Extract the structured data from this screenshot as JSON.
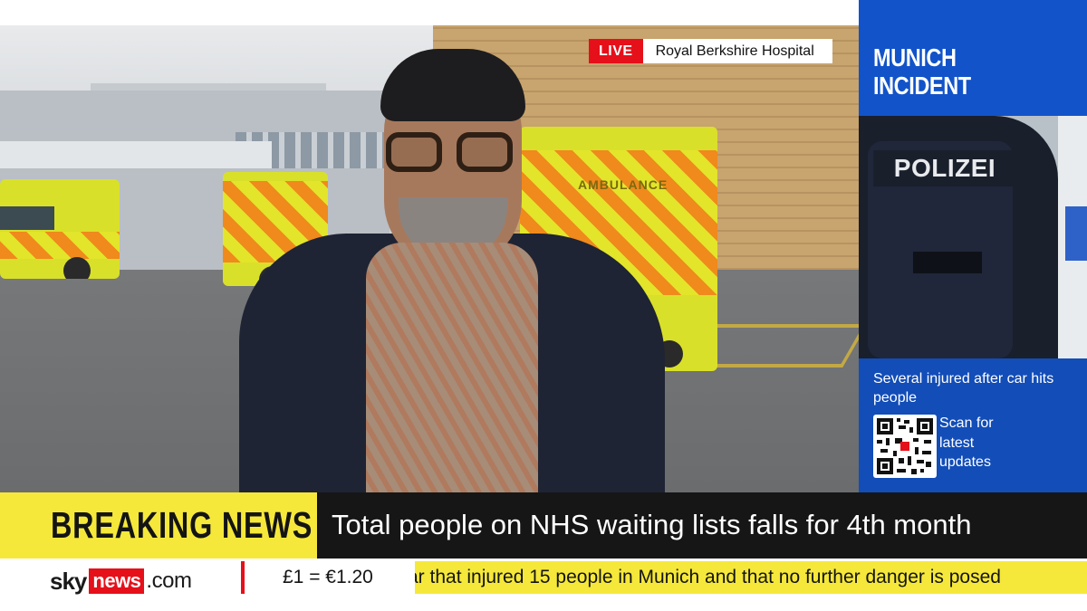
{
  "live_tag": {
    "label": "LIVE",
    "location": "Royal Berkshire Hospital"
  },
  "vehicle_text": "AMBULANCE",
  "side_panel": {
    "title": "MUNICH\nINCIDENT",
    "photo_text": "POLIZEI",
    "subtitle": "Several injured after car hits people",
    "scan_text": "Scan for latest updates"
  },
  "breaking": {
    "label": "BREAKING NEWS",
    "headline": "Total people on NHS waiting lists falls for 4th month"
  },
  "bottom": {
    "logo_sky": "sky",
    "logo_news": "news",
    "logo_domain": ".com",
    "rate": "£1 = €1.20",
    "ticker": "ar that injured 15 people in Munich and that no further danger is posed"
  },
  "colors": {
    "sky_red": "#e5101a",
    "breaking_yellow": "#f5e83a",
    "panel_blue": "#124db8",
    "bar_black": "#161616"
  }
}
